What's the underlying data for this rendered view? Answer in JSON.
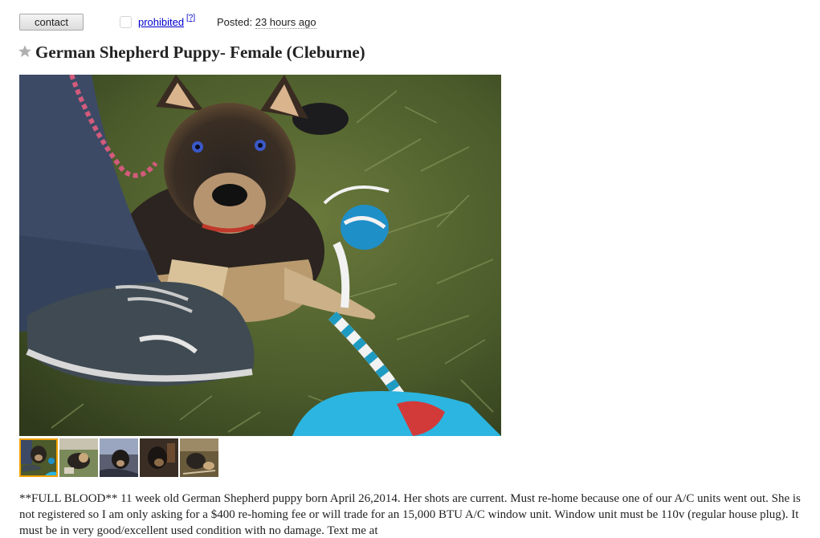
{
  "header": {
    "contact_label": "contact",
    "flag_label": "prohibited",
    "flag_help": "[?]",
    "posted_label": "Posted:",
    "posted_time": "23 hours ago"
  },
  "posting": {
    "title": "German Shepherd Puppy- Female (Cleburne)",
    "body": "**FULL BLOOD** 11 week old German Shepherd puppy born April 26,2014. Her shots are current. Must re-home because one of our A/C units went out. She is not registered so I am only asking for a $400 re-homing fee or will trade for an 15,000 BTU A/C window unit. Window unit must be 110v (regular house plug). It must be in very good/excellent used condition with no damage. Text me at"
  },
  "gallery": {
    "image_count": 5,
    "selected_index": 0,
    "selected_border_color": "#f0a000"
  },
  "colors": {
    "link": "#0000cc",
    "text": "#222222",
    "star": "#b0b0b0"
  }
}
